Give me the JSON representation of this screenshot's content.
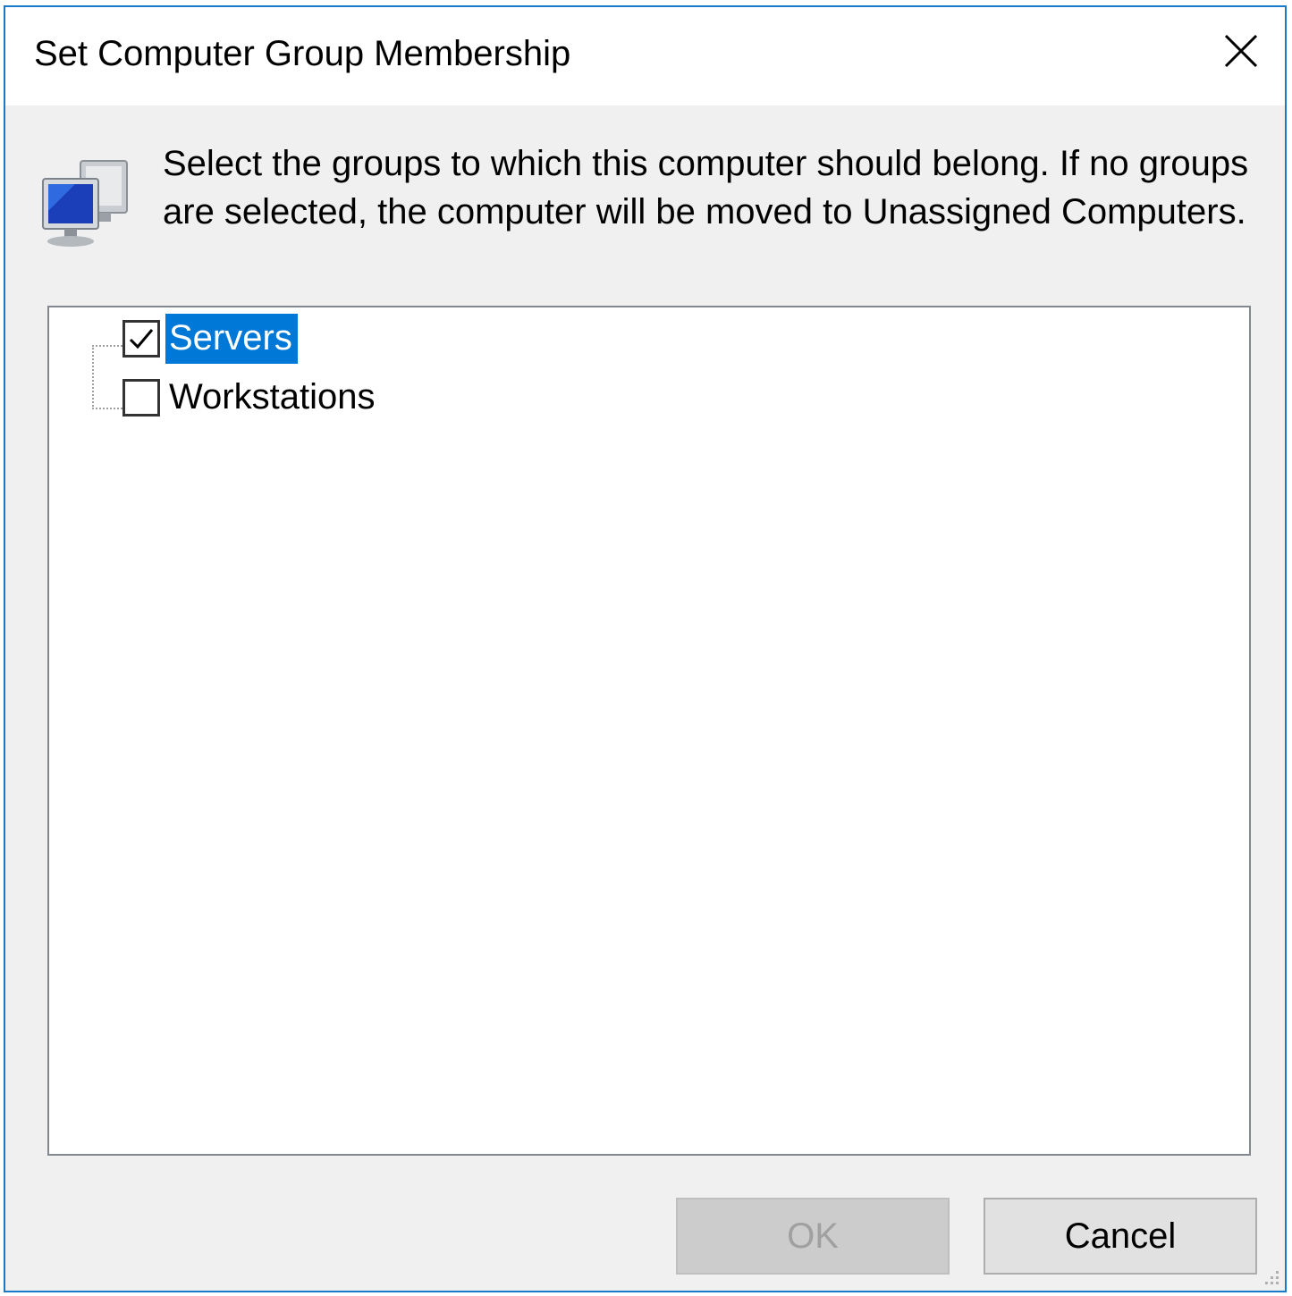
{
  "dialog": {
    "title": "Set Computer Group Membership",
    "close_icon": "close-icon",
    "computer_icon": "computer-group-icon",
    "instructions": "Select the groups to which this computer should belong. If no groups are selected, the computer will be moved to Unassigned Computers."
  },
  "groups": {
    "items": [
      {
        "label": "Servers",
        "checked": true,
        "selected": true
      },
      {
        "label": "Workstations",
        "checked": false,
        "selected": false
      }
    ]
  },
  "buttons": {
    "ok_label": "OK",
    "ok_enabled": false,
    "cancel_label": "Cancel"
  },
  "colors": {
    "accent": "#0078d7",
    "window_border": "#1979ca",
    "dialog_background": "#f0f0f0"
  }
}
